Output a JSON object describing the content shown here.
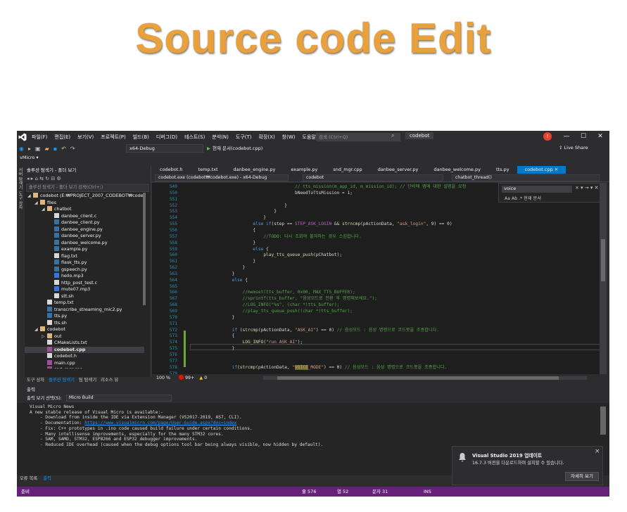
{
  "headline": "Source code Edit",
  "menu": [
    "파일(F)",
    "편집(E)",
    "보기(V)",
    "프로젝트(P)",
    "빌드(B)",
    "디버그(D)",
    "테스트(S)",
    "분석(N)",
    "도구(T)",
    "확장(X)",
    "창(W)",
    "도움말(H)"
  ],
  "search_placeholder": "검색 (Ctrl+Q)",
  "project_name": "codebot",
  "user_initial": "!",
  "window_buttons": {
    "minimize": "—",
    "maximize": "☐",
    "close": "✕"
  },
  "toolbar": {
    "config": "x64-Debug",
    "run_label": "현재 문서(codebot.cpp)",
    "live_share": "Live Share"
  },
  "vmicro_label": "vMicro ▾",
  "left_vertical_tabs": [
    "서버 탐색기",
    "도구 상자"
  ],
  "solution_explorer": {
    "title": "솔루션 탐색기 - 폴더 보기",
    "search_placeholder": "솔루션 탐색기 - 폴더 보기 검색(Ctrl+;)",
    "items": [
      {
        "label": "codebot (E:₩PROJECT_2007_CODEBOT₩codebot)",
        "depth": 0,
        "type": "fold",
        "exp": "◢"
      },
      {
        "label": "files",
        "depth": 1,
        "type": "fold",
        "exp": "◢"
      },
      {
        "label": "chatbot",
        "depth": 2,
        "type": "fold",
        "exp": "◢"
      },
      {
        "label": "danbee_client.c",
        "depth": 3,
        "type": "file"
      },
      {
        "label": "danbee_client.py",
        "depth": 3,
        "type": "py"
      },
      {
        "label": "danbee_engine.py",
        "depth": 3,
        "type": "py"
      },
      {
        "label": "danbee_server.py",
        "depth": 3,
        "type": "py"
      },
      {
        "label": "danbee_welcome.py",
        "depth": 3,
        "type": "py"
      },
      {
        "label": "example.py",
        "depth": 3,
        "type": "py"
      },
      {
        "label": "flag.txt",
        "depth": 3,
        "type": "file"
      },
      {
        "label": "flask_tts.py",
        "depth": 3,
        "type": "py"
      },
      {
        "label": "gspeech.py",
        "depth": 3,
        "type": "py"
      },
      {
        "label": "hello.mp3",
        "depth": 3,
        "type": "mp3"
      },
      {
        "label": "http_post_test.c",
        "depth": 3,
        "type": "file"
      },
      {
        "label": "mute07.mp3",
        "depth": 3,
        "type": "mp3"
      },
      {
        "label": "stt.sh",
        "depth": 3,
        "type": "file"
      },
      {
        "label": "temp.txt",
        "depth": 2,
        "type": "file"
      },
      {
        "label": "transcribe_streaming_mic2.py",
        "depth": 2,
        "type": "py"
      },
      {
        "label": "tts.py",
        "depth": 2,
        "type": "py"
      },
      {
        "label": "tts.sh",
        "depth": 2,
        "type": "file"
      },
      {
        "label": "codebot",
        "depth": 1,
        "type": "fold",
        "exp": "◢"
      },
      {
        "label": "out",
        "depth": 2,
        "type": "fold",
        "exp": "▷"
      },
      {
        "label": "CMakeLists.txt",
        "depth": 2,
        "type": "file"
      },
      {
        "label": "codebot.cpp",
        "depth": 2,
        "type": "cpp",
        "selected": true
      },
      {
        "label": "codebot.h",
        "depth": 2,
        "type": "file"
      },
      {
        "label": "main.cpp",
        "depth": 2,
        "type": "cpp"
      },
      {
        "label": "snd_mgr.cpp",
        "depth": 2,
        "type": "cpp"
      }
    ],
    "bottom_tabs": [
      "도구 상자",
      "솔루션 탐색기",
      "팀 탐색기",
      "리소스 뷰"
    ]
  },
  "document_tabs": [
    "codebot.h",
    "temp.txt",
    "danbee_engine.py",
    "example.py",
    "snd_mgr.cpp",
    "danbee_server.py",
    "danbee_welcome.py",
    "tts.py",
    "codebot.cpp"
  ],
  "active_tab": "codebot.cpp",
  "nav": {
    "project": "codebot.exe (codebot₩codebot.exe) - x64-Debug",
    "scope": "codebot",
    "member": "chatbot_thread()"
  },
  "find": {
    "value": "voice",
    "scope": "현재 문서"
  },
  "editor": {
    "line_numbers": [
      "549",
      "550",
      "551",
      "552",
      "553",
      "554",
      "555",
      "556",
      "557",
      "558",
      "559",
      "560",
      "561",
      "562",
      "563",
      "564",
      "565",
      "566",
      "567",
      "568",
      "569",
      "570",
      "571",
      "572",
      "573",
      "574",
      "575",
      "576",
      "577",
      "578",
      "579",
      "580"
    ],
    "code": [
      "                                        // tts_mission(m_app_id, m_mission_id); // 단비에 앱에 대한 설명을 요청",
      "                                        bNeedToTtsMission = 1;",
      "",
      "                                    }",
      "                                }",
      "                            }",
      "                        else if(step == STEP_ASK_LOGIN && strncmp(pActionData, \"ask_login\", 9) == 0)",
      "                        {",
      "                            //TODO: 다시 조회야 불자하는 경우 스킵합니다.",
      "                        }",
      "                        else {",
      "                            play_tts_queue_push(pChatbot);",
      "                        }",
      "                    }",
      "                }",
      "                else {",
      "",
      "                    //memset(tts_buffer, 0x00, MAX_TTS_BUFFER);",
      "                    //sprintf(tts_buffer, \"음성모드로 전환 후 명령해보세요.\");",
      "                    //LOG_INFO(\"%s\", (char *)tts_buffer);",
      "                    //play_tts_queue_push((char *)tts_buffer);",
      "                }",
      "",
      "                if (strcmp(pActionData, \"ASK_AI\") == 0) // 음성모드 : 음성 명령으로 코드봇을 조종합니다.",
      "                {",
      "                    LOG_INFO(\"run ASK_AI\");",
      "                }",
      "",
      "",
      "                if(strcmp(pActionData, \"VOICE_MODE\") == 0) // 음성모드 : 음성 명령으로 코드봇을 조종합니다.",
      "",
      ""
    ]
  },
  "editor_status": {
    "zoom": "100 %",
    "errors": "99+",
    "warnings": "0"
  },
  "output": {
    "title": "출력",
    "source_label": "출력 보기 선택(S):",
    "source_value": "Micro Build",
    "lines": [
      "Visual Micro News",
      "A new stable release of Visual Micro is available:-",
      "    - Download from inside the IDE via Extension Manager (VS2017-2019, AS7, CLI).",
      "    - Documentation: https://www.visualmicro.com/page/User-Guide.aspx?doc=index",
      "    - Fix: C++ prototypes in .ino code caused build failure under certain conditions.",
      "    - Many intellisense improvements, especially for the many STM32 cores.",
      "    - SAM, SAMD, STM32, ESP8266 and ESP32 debugger improvements.",
      "    - Reduced IDE overhead (caused when the debug options tool bar being always visible, now hidden by default)."
    ],
    "bottom_tabs": [
      "오류 목록",
      "출력"
    ]
  },
  "statusbar": {
    "ready": "준비",
    "line": "줄 576",
    "col": "열 52",
    "char": "문자 31",
    "mode": "INS"
  },
  "toast": {
    "title": "Visual Studio 2019 업데이트",
    "message": "16.7.3 버전을 다운로드하여 설치할 수 있습니다.",
    "button": "자세히 보기"
  },
  "colors": {
    "accent": "#007acc",
    "statusbar": "#68217a",
    "headline": "#e8a13c"
  }
}
